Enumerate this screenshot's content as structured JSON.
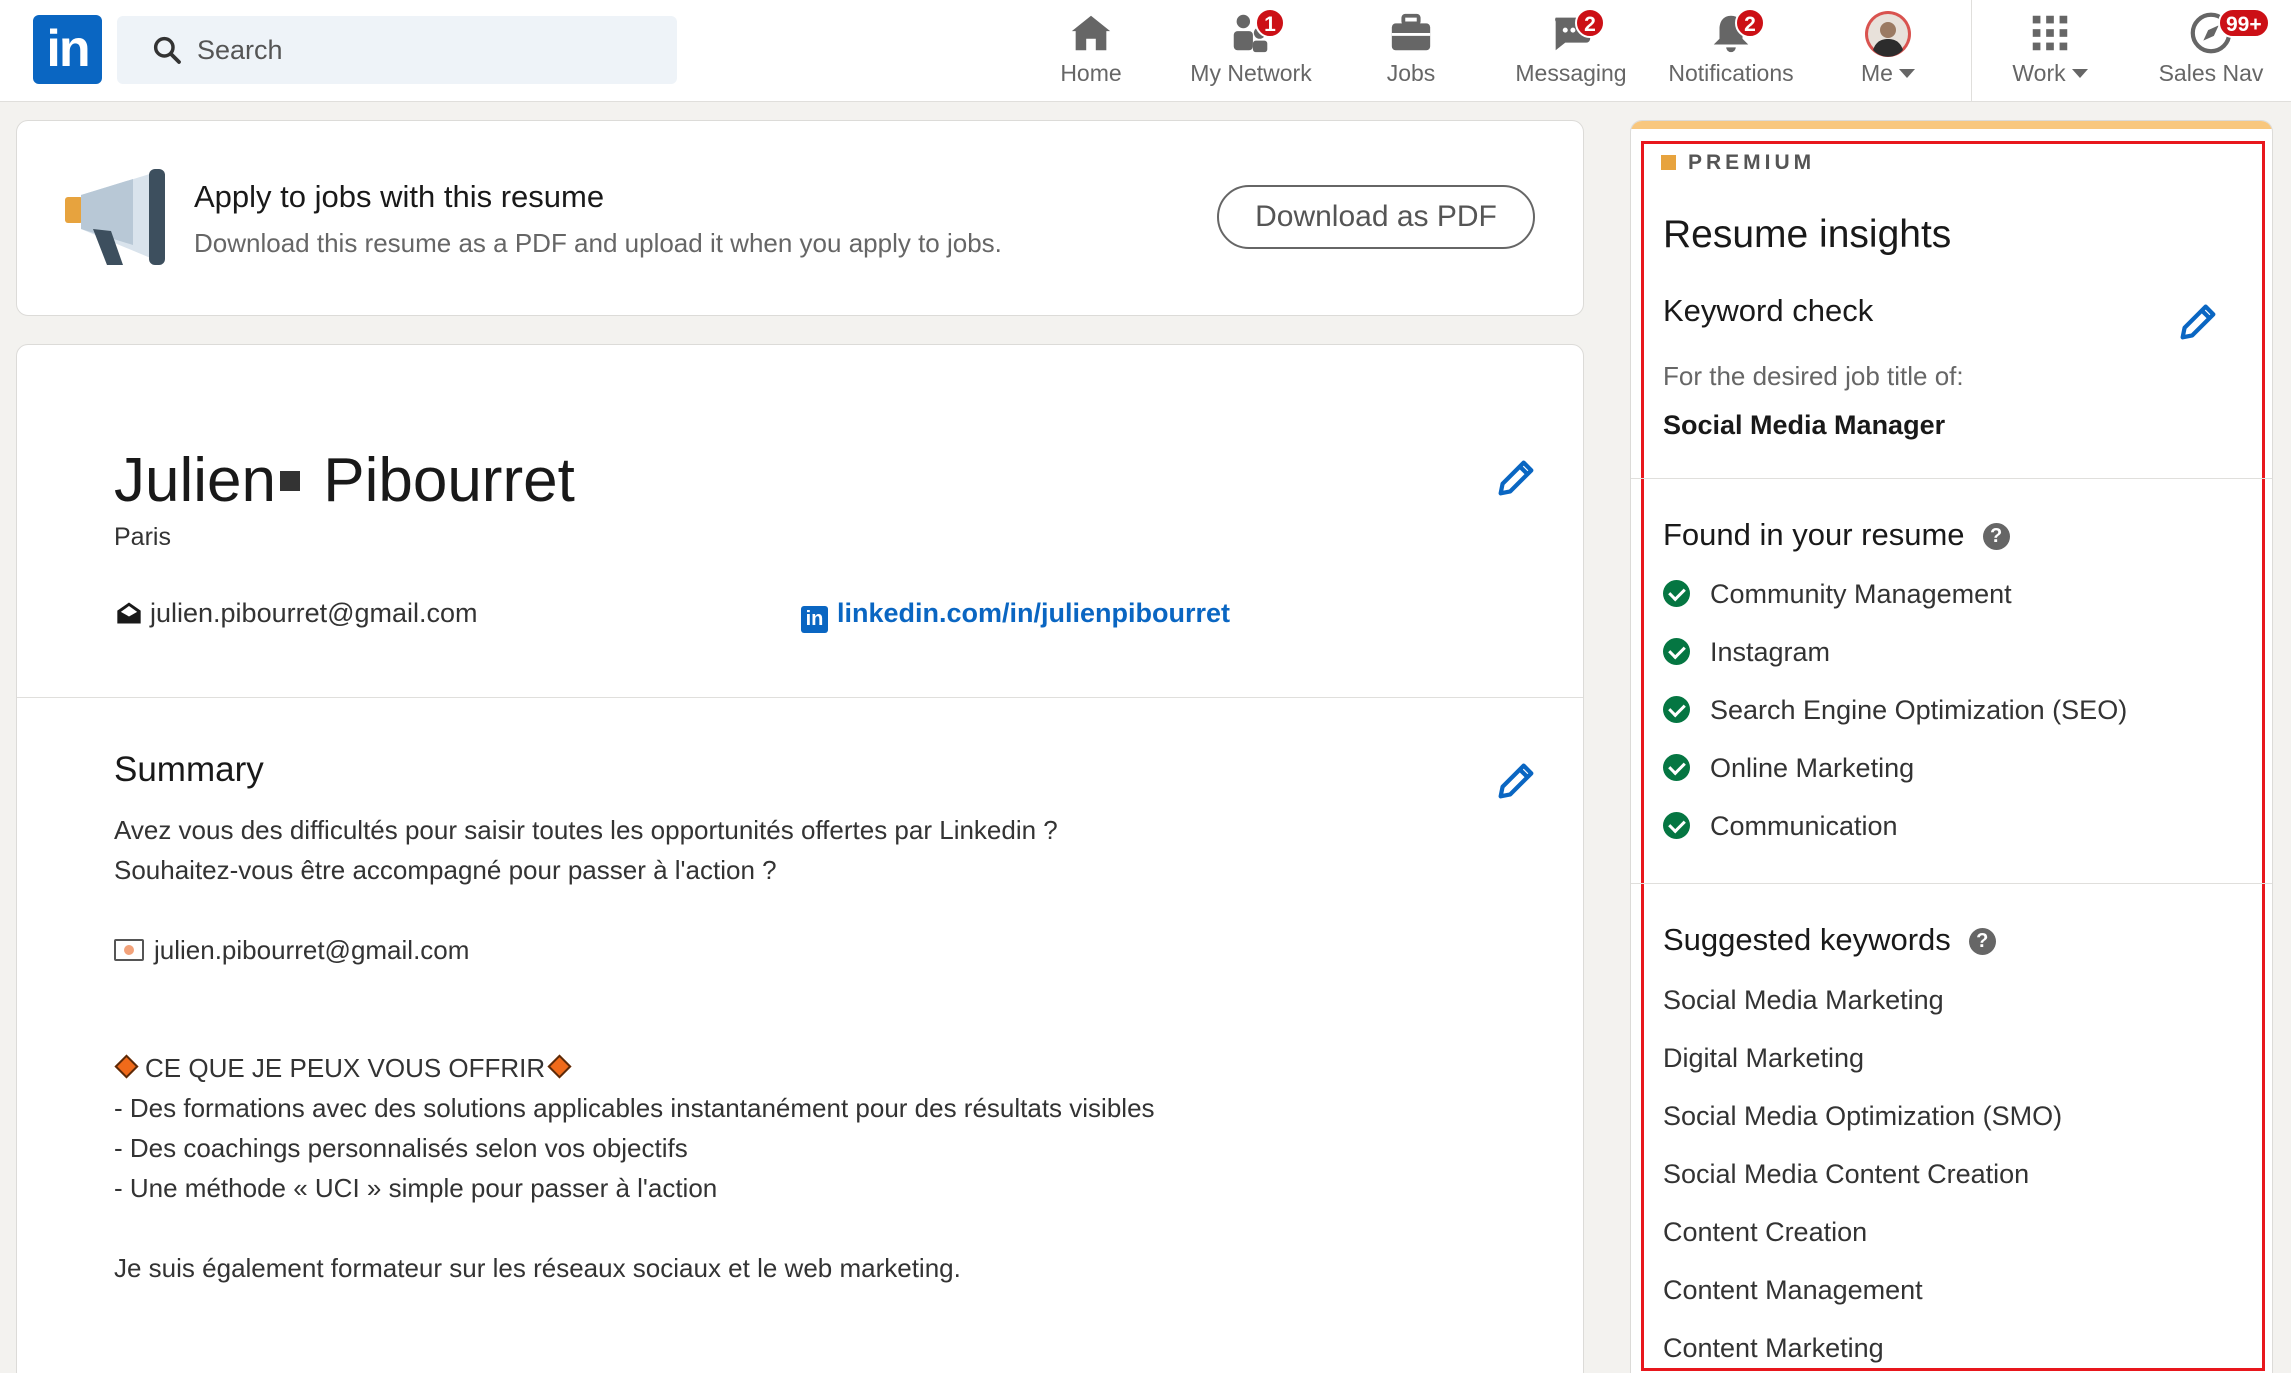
{
  "nav": {
    "search_placeholder": "Search",
    "items": [
      {
        "label": "Home"
      },
      {
        "label": "My Network",
        "badge": "1"
      },
      {
        "label": "Jobs"
      },
      {
        "label": "Messaging",
        "badge": "2"
      },
      {
        "label": "Notifications",
        "badge": "2"
      },
      {
        "label": "Me"
      },
      {
        "label": "Work"
      },
      {
        "label": "Sales Nav",
        "badge": "99+"
      }
    ]
  },
  "apply": {
    "title": "Apply to jobs with this resume",
    "subtitle": "Download this resume as a PDF and upload it when you apply to jobs.",
    "button": "Download as PDF"
  },
  "resume": {
    "first_name": "Julien",
    "last_name": "Pibourret",
    "city": "Paris",
    "email": "julien.pibourret@gmail.com",
    "linkedin": "linkedin.com/in/julienpibourret",
    "summary_title": "Summary",
    "summary_lines": [
      "Avez vous des difficultés pour saisir toutes les opportunités offertes par Linkedin ?",
      "Souhaitez-vous être accompagné pour passer à l'action ?",
      "julien.pibourret@gmail.com",
      "CE QUE JE PEUX VOUS OFFRIR",
      "- Des formations avec des solutions applicables instantanément pour des résultats visibles",
      "- Des coachings personnalisés selon vos objectifs",
      "- Une méthode « UCI » simple pour passer à l'action",
      "Je suis également formateur sur les réseaux sociaux et le web marketing."
    ]
  },
  "insights": {
    "premium_label": "PREMIUM",
    "title": "Resume insights",
    "keyword_check": "Keyword check",
    "job_label": "For the desired job title of:",
    "job_title": "Social Media Manager",
    "found_title": "Found in your resume",
    "found": [
      "Community Management",
      "Instagram",
      "Search Engine Optimization (SEO)",
      "Online Marketing",
      "Communication"
    ],
    "suggested_title": "Suggested keywords",
    "suggested": [
      "Social Media Marketing",
      "Digital Marketing",
      "Social Media Optimization (SMO)",
      "Social Media Content Creation",
      "Content Creation",
      "Content Management",
      "Content Marketing"
    ]
  },
  "colors": {
    "brand": "#0a66c2",
    "badge": "#cc1016",
    "check": "#057642",
    "highlight_frame": "#e8171d"
  }
}
